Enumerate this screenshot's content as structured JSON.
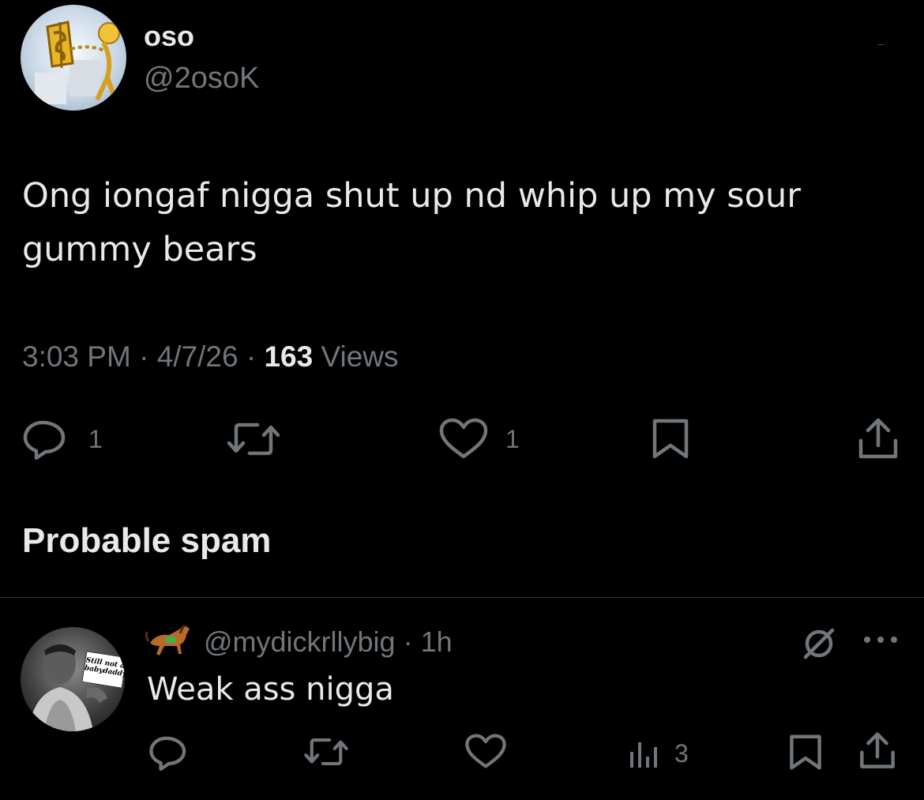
{
  "tweet": {
    "display_name": "oso",
    "handle": "@2osoK",
    "body_line1": "Ong iongaf nigga shut up nd whip up my sour",
    "body_line2": "gummy bears",
    "time": "3:03 PM",
    "sep1": "·",
    "date": "4/7/26",
    "sep2": "·",
    "views_count": "163",
    "views_label": "Views",
    "actions": {
      "reply_count": "1",
      "like_count": "1"
    }
  },
  "section": {
    "title": "Probable spam"
  },
  "reply": {
    "handle": "@mydickrllybig",
    "sep": "·",
    "time": "1h",
    "body": "Weak ass nigga",
    "sign_text": "Still not a babydaddy",
    "actions": {
      "views_count": "3"
    }
  },
  "icons": {
    "reply": "reply-icon",
    "retweet": "retweet-icon",
    "like": "heart-icon",
    "bookmark": "bookmark-icon",
    "share": "share-icon",
    "views": "views-icon",
    "more": "more-icon",
    "hidden": "hidden-slash-icon"
  },
  "colors": {
    "background": "#000000",
    "text": "#e7e9ea",
    "muted": "#71767b",
    "divider": "#2f3336"
  }
}
